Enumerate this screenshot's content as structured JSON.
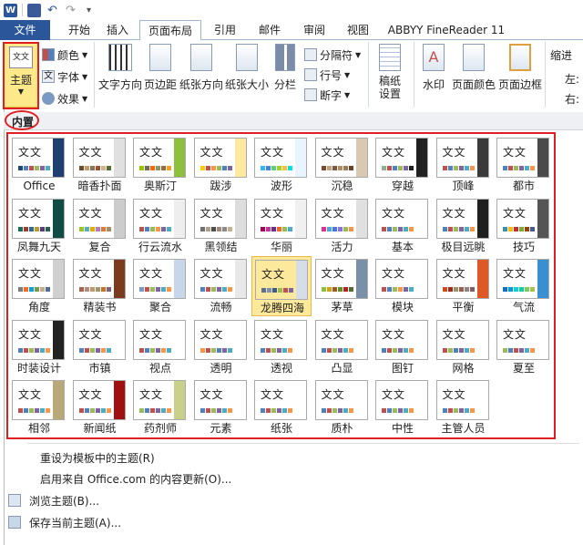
{
  "title_bar": {
    "app_icon": "W",
    "undo_label": "↶",
    "redo_label": "↷"
  },
  "tabs": [
    {
      "label": "文件",
      "active": false
    },
    {
      "label": "开始",
      "active": false
    },
    {
      "label": "插入",
      "active": false
    },
    {
      "label": "页面布局",
      "active": true
    },
    {
      "label": "引用",
      "active": false
    },
    {
      "label": "邮件",
      "active": false
    },
    {
      "label": "审阅",
      "active": false
    },
    {
      "label": "视图",
      "active": false
    },
    {
      "label": "ABBYY FineReader 11",
      "active": false
    }
  ],
  "ribbon": {
    "theme": {
      "label": "主题",
      "icon_text": "文文"
    },
    "colors": "颜色",
    "fonts": "字体",
    "effects": "效果",
    "text_direction": "文字方向",
    "margins": "页边距",
    "orientation": "纸张方向",
    "size": "纸张大小",
    "columns": "分栏",
    "breaks": "分隔符",
    "line_numbers": "行号",
    "hyphenation": "断字",
    "draft_paper": "稿纸\n设置",
    "watermark": "水印",
    "page_color": "页面颜色",
    "page_borders": "页面边框",
    "indent": "缩进",
    "indent_left": "左:",
    "indent_right": "右:"
  },
  "panel": {
    "section_title": "内置",
    "themes": [
      {
        "name": "Office",
        "colors": [
          "#1f497d",
          "#4f81bd",
          "#c0504d",
          "#9bbb59",
          "#8064a2",
          "#4bacc6"
        ],
        "side": "#1f3f73"
      },
      {
        "name": "暗香扑面",
        "colors": [
          "#6b4c2b",
          "#c49a6c",
          "#8b7355",
          "#a0522d",
          "#d2b48c",
          "#556b2f"
        ],
        "side": "#e0e0e0"
      },
      {
        "name": "奥斯汀",
        "colors": [
          "#94c600",
          "#71685a",
          "#ff6700",
          "#909465",
          "#956b43",
          "#fea022"
        ],
        "side": "#8fbf3f"
      },
      {
        "name": "跋涉",
        "colors": [
          "#ffcc00",
          "#c0504d",
          "#f79646",
          "#9bbb59",
          "#4f81bd",
          "#8064a2"
        ],
        "side": "#ffe9a0"
      },
      {
        "name": "波形",
        "colors": [
          "#31b6fd",
          "#4584d3",
          "#5bd078",
          "#a5d028",
          "#f5c040",
          "#05e0db"
        ],
        "side": "#e8f4ff"
      },
      {
        "name": "沉稳",
        "colors": [
          "#7d4b30",
          "#c5a078",
          "#7a5a3e",
          "#b68d5e",
          "#9b7b58",
          "#6b4226"
        ],
        "side": "#d9c8b2"
      },
      {
        "name": "穿越",
        "colors": [
          "#8fb08c",
          "#c0504d",
          "#4f81bd",
          "#9bbb59",
          "#8064a2",
          "#1f1f1f"
        ],
        "side": "#222222"
      },
      {
        "name": "顶峰",
        "colors": [
          "#c0504d",
          "#4f81bd",
          "#9bbb59",
          "#8064a2",
          "#4bacc6",
          "#f79646"
        ],
        "side": "#3a3a3a"
      },
      {
        "name": "都市",
        "colors": [
          "#4f81bd",
          "#c0504d",
          "#9bbb59",
          "#8064a2",
          "#4bacc6",
          "#f79646"
        ],
        "side": "#4a4a4a"
      },
      {
        "name": "凤舞九天",
        "colors": [
          "#1b6b5a",
          "#9e3c2e",
          "#2f6e8a",
          "#b89b2e",
          "#5a3c7e",
          "#206050"
        ],
        "side": "#0f4d44"
      },
      {
        "name": "复合",
        "colors": [
          "#98c723",
          "#59b0b9",
          "#deae00",
          "#b77bb4",
          "#e0773c",
          "#a98d63"
        ],
        "side": "#cccccc"
      },
      {
        "name": "行云流水",
        "colors": [
          "#c0504d",
          "#4f81bd",
          "#9bbb59",
          "#f79646",
          "#8064a2",
          "#4bacc6"
        ],
        "side": "#eeeeee"
      },
      {
        "name": "黑领结",
        "colors": [
          "#6f6f6f",
          "#b0a08a",
          "#4f4f4f",
          "#a08a78",
          "#8a8a8a",
          "#c0b090"
        ],
        "side": "#dddddd"
      },
      {
        "name": "华丽",
        "colors": [
          "#a8005b",
          "#c5339b",
          "#6d2c8c",
          "#f26a21",
          "#9bbb59",
          "#4bacc6"
        ],
        "side": "#f0f0f0"
      },
      {
        "name": "活力",
        "colors": [
          "#e32d91",
          "#4ea6dc",
          "#4775e7",
          "#8971e1",
          "#9bbb59",
          "#f79646"
        ],
        "side": "#e0e0e0"
      },
      {
        "name": "基本",
        "colors": [
          "#c0504d",
          "#4f81bd",
          "#9bbb59",
          "#8064a2",
          "#4bacc6",
          "#f79646"
        ],
        "side": "#ffffff"
      },
      {
        "name": "极目远眺",
        "colors": [
          "#4f81bd",
          "#c0504d",
          "#9bbb59",
          "#8064a2",
          "#4bacc6",
          "#f79646"
        ],
        "side": "#1f1f1f"
      },
      {
        "name": "技巧",
        "colors": [
          "#3891a7",
          "#feb80a",
          "#c32d2e",
          "#84aa33",
          "#964305",
          "#475a8d"
        ],
        "side": "#555555"
      },
      {
        "name": "角度",
        "colors": [
          "#797b7e",
          "#f96a1b",
          "#08a1d9",
          "#7c984a",
          "#c2ad8d",
          "#506e94"
        ],
        "side": "#d0d0d0"
      },
      {
        "name": "精装书",
        "colors": [
          "#a5644e",
          "#b58b80",
          "#c3986d",
          "#a19574",
          "#c17529",
          "#826277"
        ],
        "side": "#7a3b1e"
      },
      {
        "name": "聚合",
        "colors": [
          "#7a9ac5",
          "#c0504d",
          "#9bbb59",
          "#8064a2",
          "#4bacc6",
          "#f79646"
        ],
        "side": "#c8d6ea"
      },
      {
        "name": "流畅",
        "colors": [
          "#4f81bd",
          "#c0504d",
          "#9bbb59",
          "#8064a2",
          "#4bacc6",
          "#f79646"
        ],
        "side": "#e8e8e8"
      },
      {
        "name": "龙腾四海",
        "colors": [
          "#5d6e8e",
          "#7f8fae",
          "#3e5a87",
          "#9bbb59",
          "#c0504d",
          "#8064a2"
        ],
        "side": "#d5dde8"
      },
      {
        "name": "茅草",
        "colors": [
          "#8fbf3f",
          "#d4a017",
          "#9e5a24",
          "#6b8e23",
          "#b22222",
          "#556b2f"
        ],
        "side": "#7a8fa8"
      },
      {
        "name": "模块",
        "colors": [
          "#c0504d",
          "#4f81bd",
          "#9bbb59",
          "#f79646",
          "#8064a2",
          "#4bacc6"
        ],
        "side": "#ffffff"
      },
      {
        "name": "平衡",
        "colors": [
          "#d34817",
          "#9b2d1f",
          "#a28e6a",
          "#956251",
          "#918485",
          "#855d5d"
        ],
        "side": "#dd5a28"
      },
      {
        "name": "气流",
        "colors": [
          "#0f6fc6",
          "#009dd9",
          "#0bd0d9",
          "#10cf9b",
          "#7cca62",
          "#a5c249"
        ],
        "side": "#3a8fd0"
      },
      {
        "name": "时装设计",
        "colors": [
          "#4f81bd",
          "#c0504d",
          "#9bbb59",
          "#8064a2",
          "#4bacc6",
          "#f79646"
        ],
        "side": "#222222"
      },
      {
        "name": "市镇",
        "colors": [
          "#4f81bd",
          "#c0504d",
          "#9bbb59",
          "#8064a2",
          "#f79646",
          "#4bacc6"
        ],
        "side": "#ffffff"
      },
      {
        "name": "视点",
        "colors": [
          "#c0504d",
          "#4f81bd",
          "#9bbb59",
          "#8064a2",
          "#f79646",
          "#4bacc6"
        ],
        "side": "#ffffff"
      },
      {
        "name": "透明",
        "colors": [
          "#f79646",
          "#c0504d",
          "#9bbb59",
          "#4f81bd",
          "#8064a2",
          "#4bacc6"
        ],
        "side": "#ffffff"
      },
      {
        "name": "透视",
        "colors": [
          "#4f81bd",
          "#c0504d",
          "#9bbb59",
          "#8064a2",
          "#4bacc6",
          "#f79646"
        ],
        "side": "#ffffff"
      },
      {
        "name": "凸显",
        "colors": [
          "#4f81bd",
          "#c0504d",
          "#9bbb59",
          "#8064a2",
          "#4bacc6",
          "#f79646"
        ],
        "side": "#ffffff"
      },
      {
        "name": "图钉",
        "colors": [
          "#4f81bd",
          "#c0504d",
          "#9bbb59",
          "#8064a2",
          "#4bacc6",
          "#f79646"
        ],
        "side": "#ffffff"
      },
      {
        "name": "网格",
        "colors": [
          "#c0504d",
          "#9bbb59",
          "#4f81bd",
          "#8064a2",
          "#4bacc6",
          "#f79646"
        ],
        "side": "#ffffff"
      },
      {
        "name": "夏至",
        "colors": [
          "#9bbb59",
          "#4f81bd",
          "#c0504d",
          "#8064a2",
          "#4bacc6",
          "#f79646"
        ],
        "side": "#ffffff"
      },
      {
        "name": "相邻",
        "colors": [
          "#c0504d",
          "#4f81bd",
          "#9bbb59",
          "#8064a2",
          "#4bacc6",
          "#f79646"
        ],
        "side": "#b8a87a"
      },
      {
        "name": "新闻纸",
        "colors": [
          "#c0504d",
          "#4f81bd",
          "#9bbb59",
          "#8064a2",
          "#4bacc6",
          "#f79646"
        ],
        "side": "#a01010"
      },
      {
        "name": "药剂师",
        "colors": [
          "#9bbb59",
          "#4f81bd",
          "#c0504d",
          "#8064a2",
          "#4bacc6",
          "#f79646"
        ],
        "side": "#c8d08a"
      },
      {
        "name": "元素",
        "colors": [
          "#4f81bd",
          "#c0504d",
          "#9bbb59",
          "#8064a2",
          "#4bacc6",
          "#f79646"
        ],
        "side": "#ffffff"
      },
      {
        "name": "纸张",
        "colors": [
          "#4f81bd",
          "#c0504d",
          "#9bbb59",
          "#8064a2",
          "#4bacc6",
          "#f79646"
        ],
        "side": "#ffffff"
      },
      {
        "name": "质朴",
        "colors": [
          "#4f81bd",
          "#c0504d",
          "#9bbb59",
          "#8064a2",
          "#4bacc6",
          "#f79646"
        ],
        "side": "#ffffff"
      },
      {
        "name": "中性",
        "colors": [
          "#c0504d",
          "#4f81bd",
          "#9bbb59",
          "#8064a2",
          "#4bacc6",
          "#f79646"
        ],
        "side": "#ffffff"
      },
      {
        "name": "主管人员",
        "colors": [
          "#4f81bd",
          "#c0504d",
          "#9bbb59",
          "#8064a2",
          "#4bacc6",
          "#f79646"
        ],
        "side": "#ffffff"
      }
    ],
    "selected_theme": "龙腾四海"
  },
  "menu": [
    {
      "label": "重设为模板中的主题(R)",
      "icon": "none"
    },
    {
      "label": "启用来自 Office.com 的内容更新(O)...",
      "icon": "none"
    },
    {
      "label": "浏览主题(B)...",
      "icon": "browse-icon"
    },
    {
      "label": "保存当前主题(A)...",
      "icon": "save-theme-icon"
    }
  ],
  "colors": {
    "accent": "#2b579a",
    "highlight": "#e02020",
    "selected": "#fde99b"
  }
}
